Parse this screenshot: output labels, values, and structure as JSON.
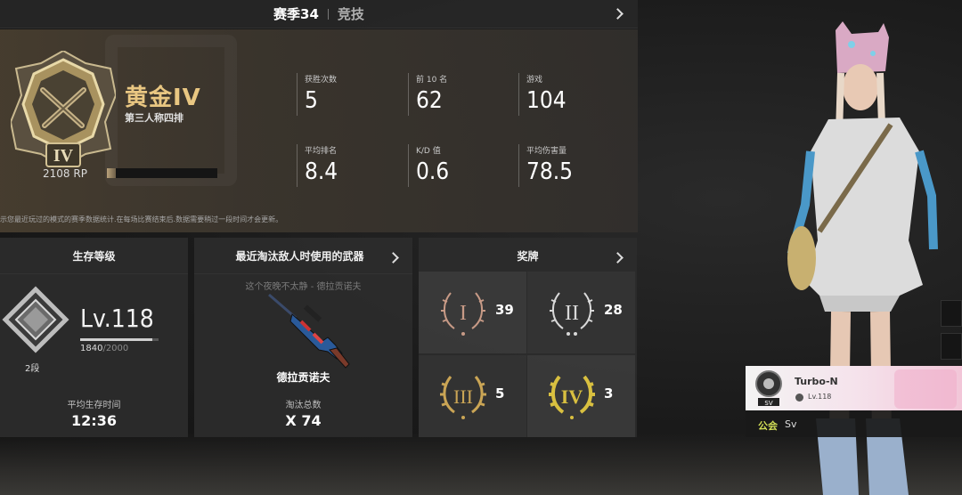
{
  "header": {
    "season": "赛季34",
    "mode": "竞技"
  },
  "rank": {
    "tier_name": "黄金IV",
    "tier_numeral": "IV",
    "mode": "第三人称四排",
    "rp": "2108 RP",
    "rp_progress": 0.08
  },
  "stats": [
    {
      "label": "获胜次数",
      "value": "5"
    },
    {
      "label": "前 10 名",
      "value": "62"
    },
    {
      "label": "游戏",
      "value": "104"
    },
    {
      "label": "平均排名",
      "value": "8.4"
    },
    {
      "label": "K/D 值",
      "value": "0.6"
    },
    {
      "label": "平均伤害量",
      "value": "78.5"
    }
  ],
  "footnote": "示您最近玩过的模式的赛季数据统计.在每场比赛结束后.数据需要稍过一段时间才会更新。",
  "survival": {
    "title": "生存等级",
    "level": "Lv.118",
    "xp_current": "1840",
    "xp_max": "/2000",
    "xp_progress": 0.92,
    "tier": "2段",
    "avg_label": "平均生存时间",
    "avg_value": "12:36"
  },
  "weapon": {
    "title": "最近淘汰敌人时使用的武器",
    "skin_name": "这个夜晚不太静 - 德拉贡诺夫",
    "weapon_name": "德拉贡诺夫",
    "kills_label": "淘汰总数",
    "kills_value": "X 74"
  },
  "medals": {
    "title": "奖牌",
    "items": [
      {
        "numeral": "I",
        "count": "39",
        "color": "#c79a86"
      },
      {
        "numeral": "II",
        "count": "28",
        "color": "#d9d9d9"
      },
      {
        "numeral": "III",
        "count": "5",
        "color": "#caa555"
      },
      {
        "numeral": "IV",
        "count": "3",
        "color": "#d9c040"
      }
    ]
  },
  "guild": {
    "player_name": "Turbo-N",
    "player_level": "Lv.118",
    "badge_text": "SV",
    "label": "公会",
    "value": "Sv"
  },
  "colors": {
    "gold": "#e9c782",
    "guild_label": "#d4e157"
  }
}
